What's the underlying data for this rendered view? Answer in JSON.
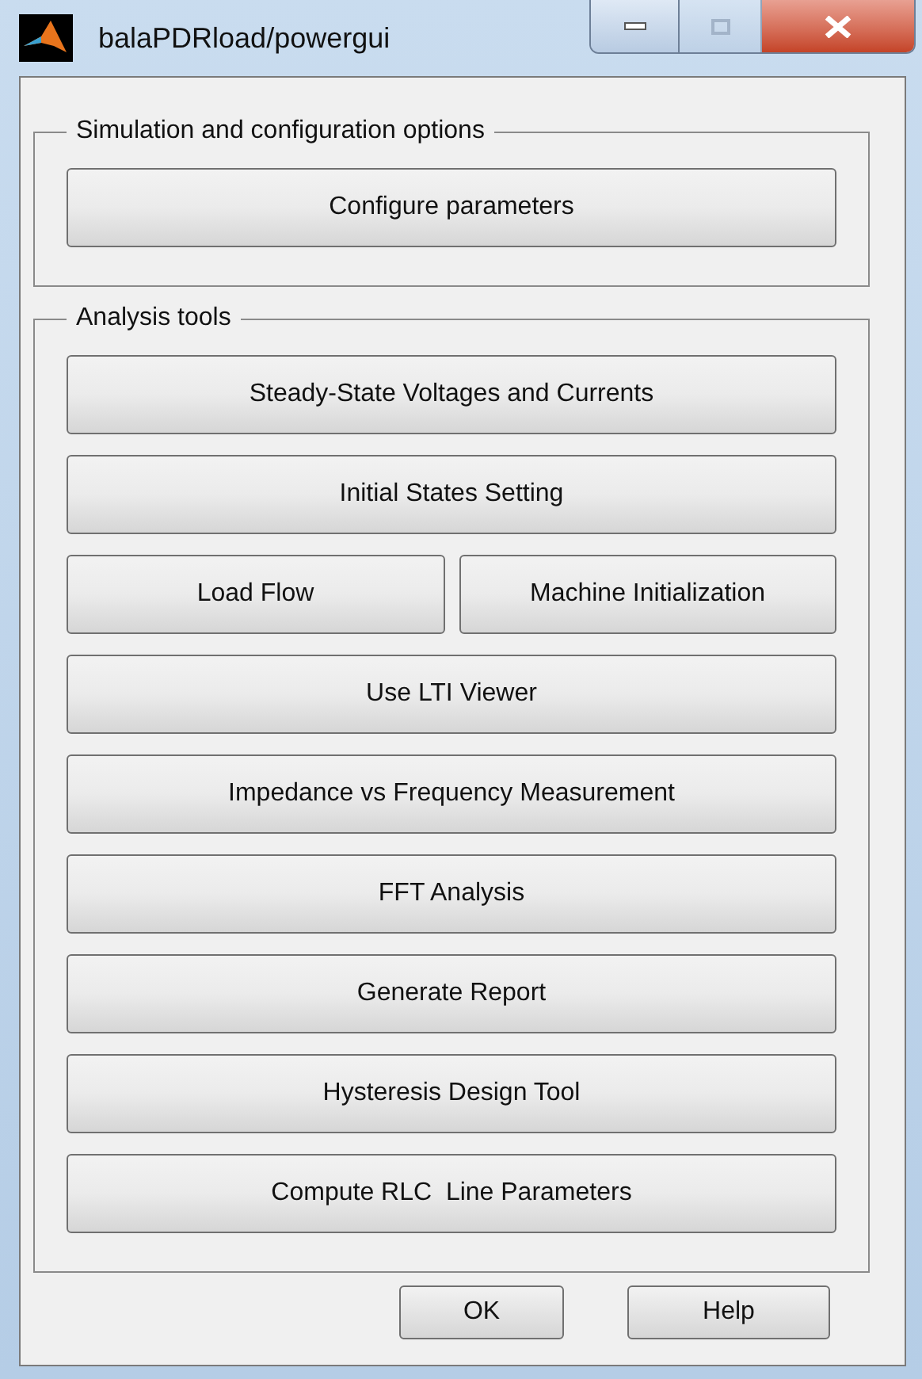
{
  "window": {
    "title": "balaPDRload/powergui"
  },
  "groups": [
    {
      "title": "Simulation and configuration options",
      "rows": [
        {
          "kind": "single",
          "buttons": [
            "Configure parameters"
          ]
        }
      ]
    },
    {
      "title": "Analysis tools",
      "rows": [
        {
          "kind": "single",
          "buttons": [
            "Steady-State Voltages and Currents"
          ]
        },
        {
          "kind": "single",
          "buttons": [
            "Initial States Setting"
          ]
        },
        {
          "kind": "pair",
          "buttons": [
            "Load Flow",
            "Machine Initialization"
          ]
        },
        {
          "kind": "single",
          "buttons": [
            "Use LTI Viewer"
          ]
        },
        {
          "kind": "single",
          "buttons": [
            "Impedance vs Frequency Measurement"
          ]
        },
        {
          "kind": "single",
          "buttons": [
            "FFT Analysis"
          ]
        },
        {
          "kind": "single",
          "buttons": [
            "Generate Report"
          ]
        },
        {
          "kind": "single",
          "buttons": [
            "Hysteresis Design Tool"
          ]
        },
        {
          "kind": "single",
          "buttons": [
            "Compute RLC  Line Parameters"
          ]
        }
      ]
    }
  ],
  "footer_buttons": [
    "OK",
    "Help"
  ]
}
